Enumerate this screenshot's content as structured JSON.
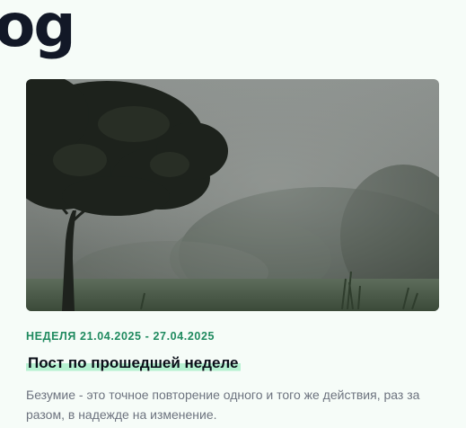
{
  "page": {
    "title": "og"
  },
  "post": {
    "date_label": "НЕДЕЛЯ 21.04.2025 - 27.04.2025",
    "title": "Пост по прошедшей неделе",
    "excerpt": "Безумие - это точное повторение одного и того же действия, раз за разом, в надежде на изменение."
  },
  "colors": {
    "background": "#f6fcf8",
    "accent": "#1f8a5f",
    "highlight": "#b6f1d1",
    "heading": "#121827",
    "muted_text": "#6d737f"
  }
}
